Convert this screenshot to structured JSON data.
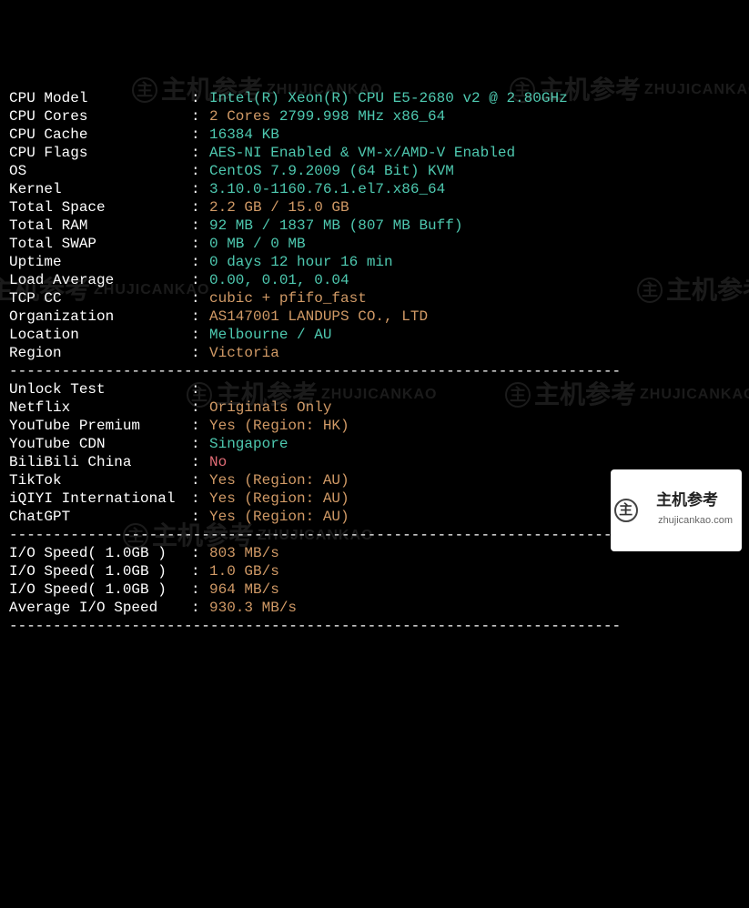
{
  "divider": "----------------------------------------------------------------------",
  "rows": [
    {
      "label": "CPU Model",
      "segments": [
        {
          "text": "Intel(R) Xeon(R) CPU E5-2680 v2 @ 2.80GHz",
          "cls": "val-cyan"
        }
      ]
    },
    {
      "label": "CPU Cores",
      "segments": [
        {
          "text": "2 Cores",
          "cls": "val-orange"
        },
        {
          "text": " 2799.998 MHz x86_64",
          "cls": "val-cyan"
        }
      ]
    },
    {
      "label": "CPU Cache",
      "segments": [
        {
          "text": "16384 KB",
          "cls": "val-cyan"
        }
      ]
    },
    {
      "label": "CPU Flags",
      "segments": [
        {
          "text": "AES-NI Enabled & VM-x/AMD-V Enabled",
          "cls": "val-cyan"
        }
      ]
    },
    {
      "label": "OS",
      "segments": [
        {
          "text": "CentOS 7.9.2009 (64 Bit) KVM",
          "cls": "val-cyan"
        }
      ]
    },
    {
      "label": "Kernel",
      "segments": [
        {
          "text": "3.10.0-1160.76.1.el7.x86_64",
          "cls": "val-cyan"
        }
      ]
    },
    {
      "label": "Total Space",
      "segments": [
        {
          "text": "2.2 GB / 15.0 GB",
          "cls": "val-orange"
        }
      ]
    },
    {
      "label": "Total RAM",
      "segments": [
        {
          "text": "92 MB / 1837 MB (807 MB Buff)",
          "cls": "val-cyan"
        }
      ]
    },
    {
      "label": "Total SWAP",
      "segments": [
        {
          "text": "0 MB / 0 MB",
          "cls": "val-cyan"
        }
      ]
    },
    {
      "label": "Uptime",
      "segments": [
        {
          "text": "0 days 12 hour 16 min",
          "cls": "val-cyan"
        }
      ]
    },
    {
      "label": "Load Average",
      "segments": [
        {
          "text": "0.00, 0.01, 0.04",
          "cls": "val-cyan"
        }
      ]
    },
    {
      "label": "TCP CC",
      "segments": [
        {
          "text": "cubic + pfifo_fast",
          "cls": "val-orange"
        }
      ]
    },
    {
      "label": "Organization",
      "segments": [
        {
          "text": "AS147001 LANDUPS CO., LTD",
          "cls": "val-orange"
        }
      ]
    },
    {
      "label": "Location",
      "segments": [
        {
          "text": "Melbourne / AU",
          "cls": "val-cyan"
        }
      ]
    },
    {
      "label": "Region",
      "segments": [
        {
          "text": "Victoria",
          "cls": "val-orange"
        }
      ]
    },
    {
      "divider": true
    },
    {
      "label": "Unlock Test",
      "segments": [
        {
          "text": "",
          "cls": "val-white"
        }
      ]
    },
    {
      "label": "Netflix",
      "segments": [
        {
          "text": "Originals Only",
          "cls": "val-orange"
        }
      ]
    },
    {
      "label": "YouTube Premium",
      "segments": [
        {
          "text": "Yes (Region: HK)",
          "cls": "val-orange"
        }
      ]
    },
    {
      "label": "YouTube CDN",
      "segments": [
        {
          "text": "Singapore",
          "cls": "val-cyan"
        }
      ]
    },
    {
      "label": "BiliBili China",
      "segments": [
        {
          "text": "No",
          "cls": "val-red"
        }
      ]
    },
    {
      "label": "TikTok",
      "segments": [
        {
          "text": "Yes (Region: AU)",
          "cls": "val-orange"
        }
      ]
    },
    {
      "label": "iQIYI International",
      "segments": [
        {
          "text": "Yes (Region: AU)",
          "cls": "val-orange"
        }
      ]
    },
    {
      "label": "ChatGPT",
      "segments": [
        {
          "text": "Yes (Region: AU)",
          "cls": "val-orange"
        }
      ]
    },
    {
      "divider": true
    },
    {
      "label": "I/O Speed( 1.0GB )",
      "segments": [
        {
          "text": "803 MB/s",
          "cls": "val-orange"
        }
      ]
    },
    {
      "label": "I/O Speed( 1.0GB )",
      "segments": [
        {
          "text": "1.0 GB/s",
          "cls": "val-orange"
        }
      ]
    },
    {
      "label": "I/O Speed( 1.0GB )",
      "segments": [
        {
          "text": "964 MB/s",
          "cls": "val-orange"
        }
      ]
    },
    {
      "label": "Average I/O Speed",
      "segments": [
        {
          "text": "930.3 MB/s",
          "cls": "val-orange"
        }
      ]
    },
    {
      "divider": true
    }
  ],
  "watermark": {
    "main": "主机参考",
    "sub": "ZHUJICANKAO",
    "badge_url": "zhujicankao.com"
  }
}
